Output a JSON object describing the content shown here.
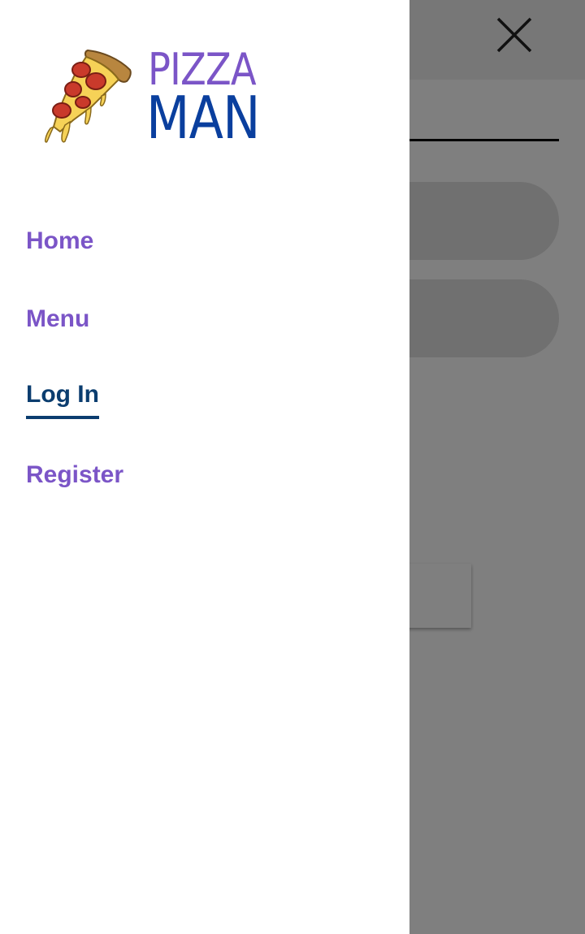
{
  "brand": {
    "logo_line1": "PIZZA",
    "logo_line2": "MAN",
    "logo_icon": "pizza-slice-icon",
    "colors": {
      "primary_purple": "#7b55c7",
      "brand_blue": "#0a3f9e",
      "active_navy": "#0b3d6f"
    }
  },
  "nav": {
    "items": [
      {
        "label": "Home",
        "active": false
      },
      {
        "label": "Menu",
        "active": false
      },
      {
        "label": "Log In",
        "active": true
      },
      {
        "label": "Register",
        "active": false
      }
    ]
  },
  "close": {
    "icon": "close-icon"
  },
  "overlay": {
    "color": "#000000",
    "opacity": 0.5
  }
}
